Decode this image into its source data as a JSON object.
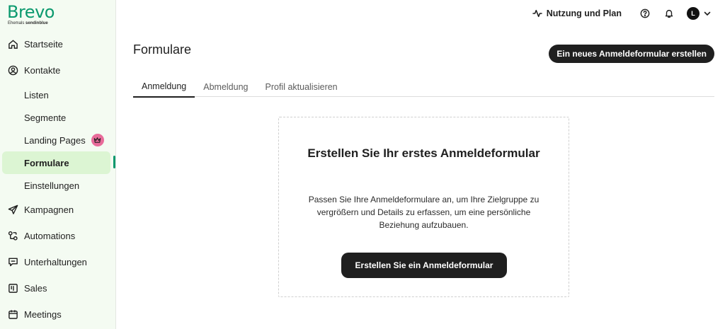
{
  "logo": {
    "brand": "Brevo",
    "sub_prefix": "Ehemals",
    "sub_brand": "sendinblue"
  },
  "sidebar": {
    "items": [
      {
        "label": "Startseite",
        "icon": "home-icon"
      },
      {
        "label": "Kontakte",
        "icon": "user-circle-icon"
      },
      {
        "label": "Listen"
      },
      {
        "label": "Segmente"
      },
      {
        "label": "Landing Pages",
        "badge_icon": "crown-icon"
      },
      {
        "label": "Formulare",
        "active": true
      },
      {
        "label": "Einstellungen"
      },
      {
        "label": "Kampagnen",
        "icon": "send-icon"
      },
      {
        "label": "Automations",
        "icon": "automation-icon"
      },
      {
        "label": "Unterhaltungen",
        "icon": "chat-icon"
      },
      {
        "label": "Sales",
        "icon": "board-icon"
      },
      {
        "label": "Meetings",
        "icon": "calendar-icon"
      }
    ]
  },
  "topbar": {
    "usage_label": "Nutzung und Plan",
    "avatar_initial": "L"
  },
  "page": {
    "title": "Formulare",
    "create_button": "Ein neues Anmeldeformular erstellen"
  },
  "tabs": [
    {
      "label": "Anmeldung",
      "active": true
    },
    {
      "label": "Abmeldung"
    },
    {
      "label": "Profil aktualisieren"
    }
  ],
  "empty_state": {
    "title": "Erstellen Sie Ihr erstes Anmeldeformular",
    "description": "Passen Sie Ihre Anmeldeformulare an, um Ihre Zielgruppe zu vergrößern und Details zu erfassen, um eine persönliche Beziehung aufzubauen.",
    "button": "Erstellen Sie ein Anmeldeformular"
  },
  "colors": {
    "brand_green": "#0b996e",
    "sidebar_bg": "#f4fbf2",
    "active_item_bg": "#dcf5d3",
    "crown_badge": "#e86b9a",
    "button_dark": "#1f1f1f"
  }
}
